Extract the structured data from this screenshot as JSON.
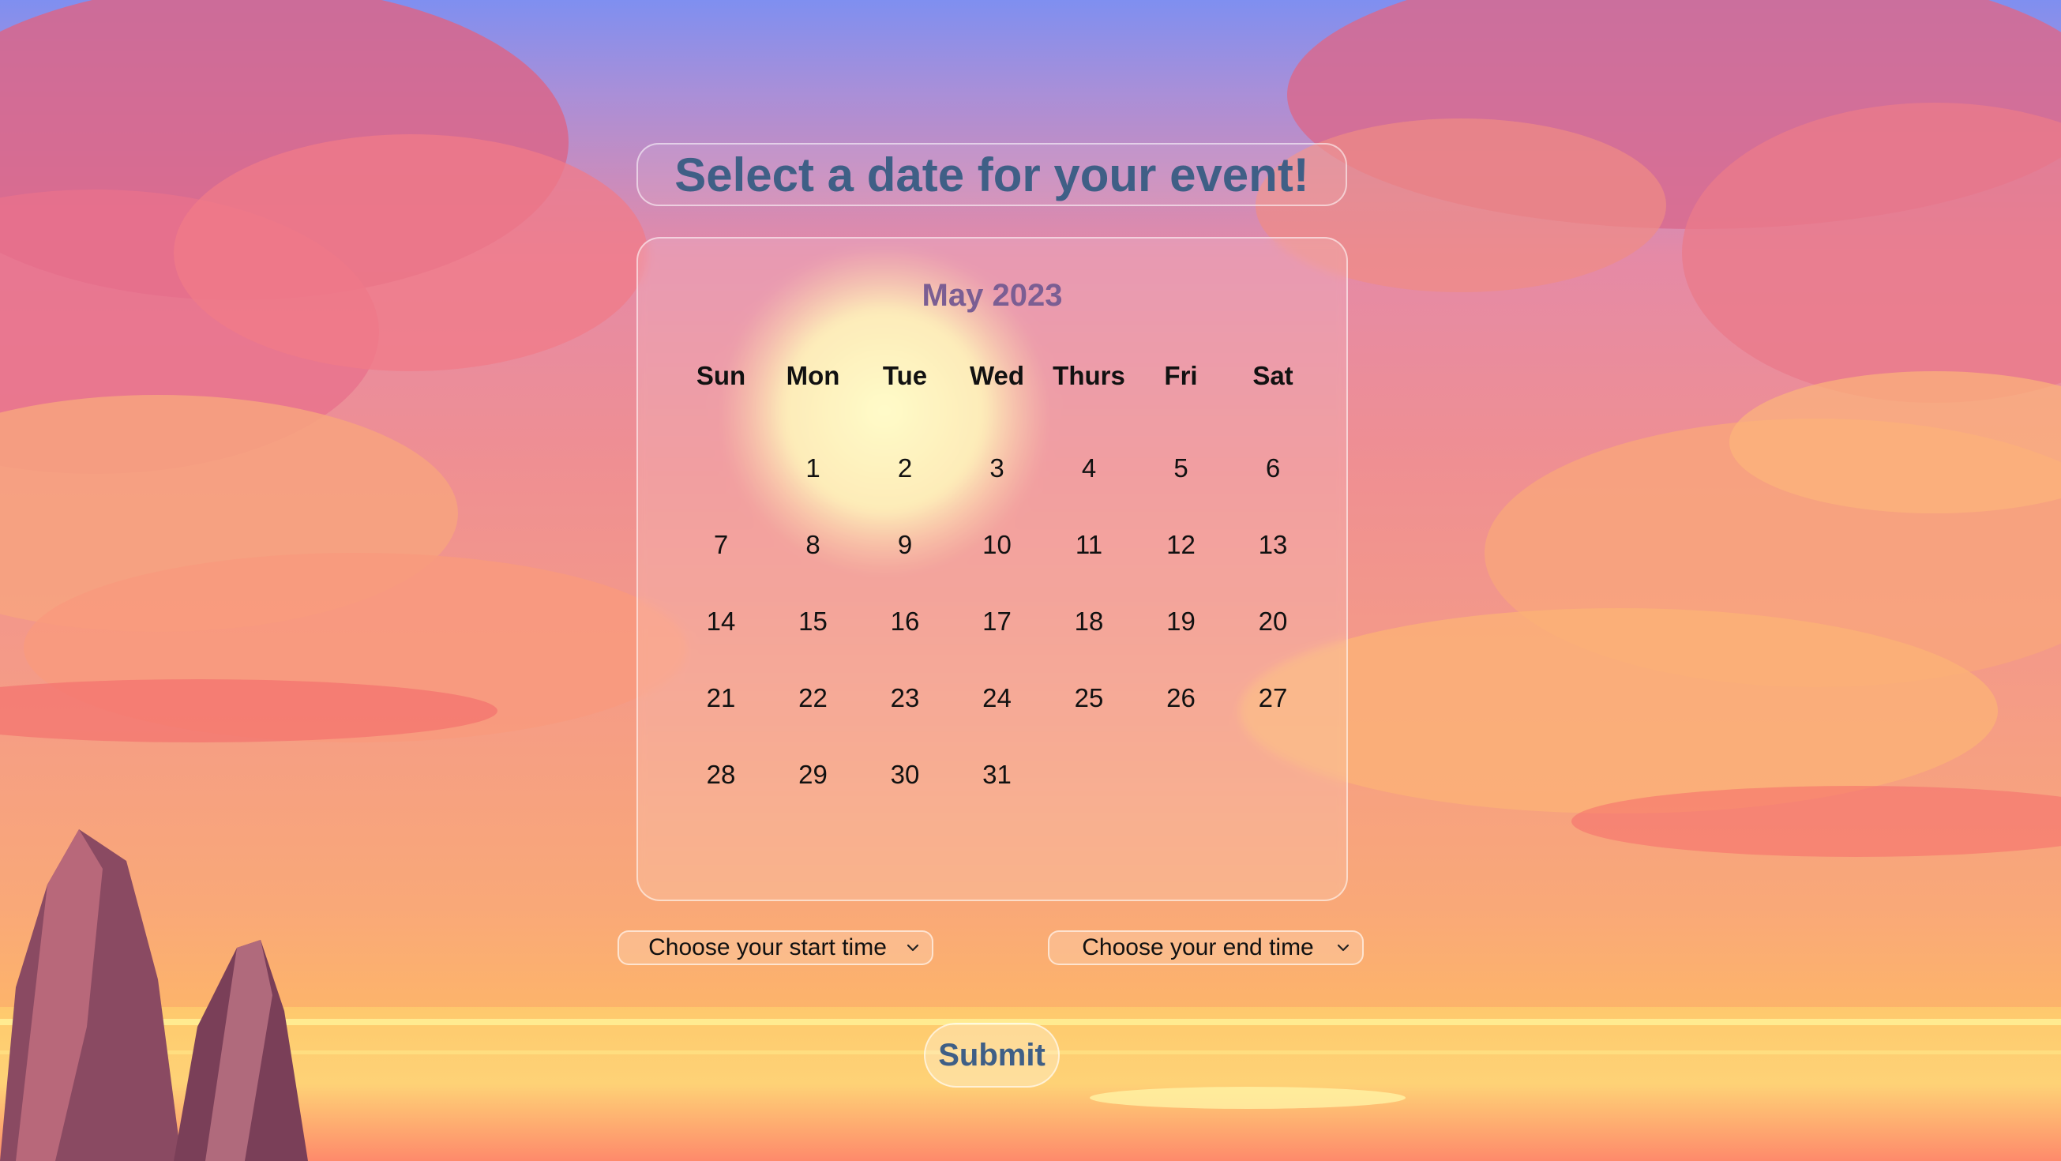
{
  "page": {
    "title": "Select a date for your event!"
  },
  "calendar": {
    "month_label": "May 2023",
    "weekdays": [
      "Sun",
      "Mon",
      "Tue",
      "Wed",
      "Thurs",
      "Fri",
      "Sat"
    ],
    "weeks": [
      [
        "",
        "1",
        "2",
        "3",
        "4",
        "5",
        "6"
      ],
      [
        "7",
        "8",
        "9",
        "10",
        "11",
        "12",
        "13"
      ],
      [
        "14",
        "15",
        "16",
        "17",
        "18",
        "19",
        "20"
      ],
      [
        "21",
        "22",
        "23",
        "24",
        "25",
        "26",
        "27"
      ],
      [
        "28",
        "29",
        "30",
        "31",
        "",
        "",
        ""
      ]
    ]
  },
  "form": {
    "start_time_select": "Choose your start time",
    "end_time_select": "Choose your end time",
    "submit_label": "Submit"
  },
  "colors": {
    "title_text": "#3f5f86",
    "month_text": "#7b5e93",
    "sky_top": "#7f8ff0",
    "sunset_band": "#fdb569"
  }
}
